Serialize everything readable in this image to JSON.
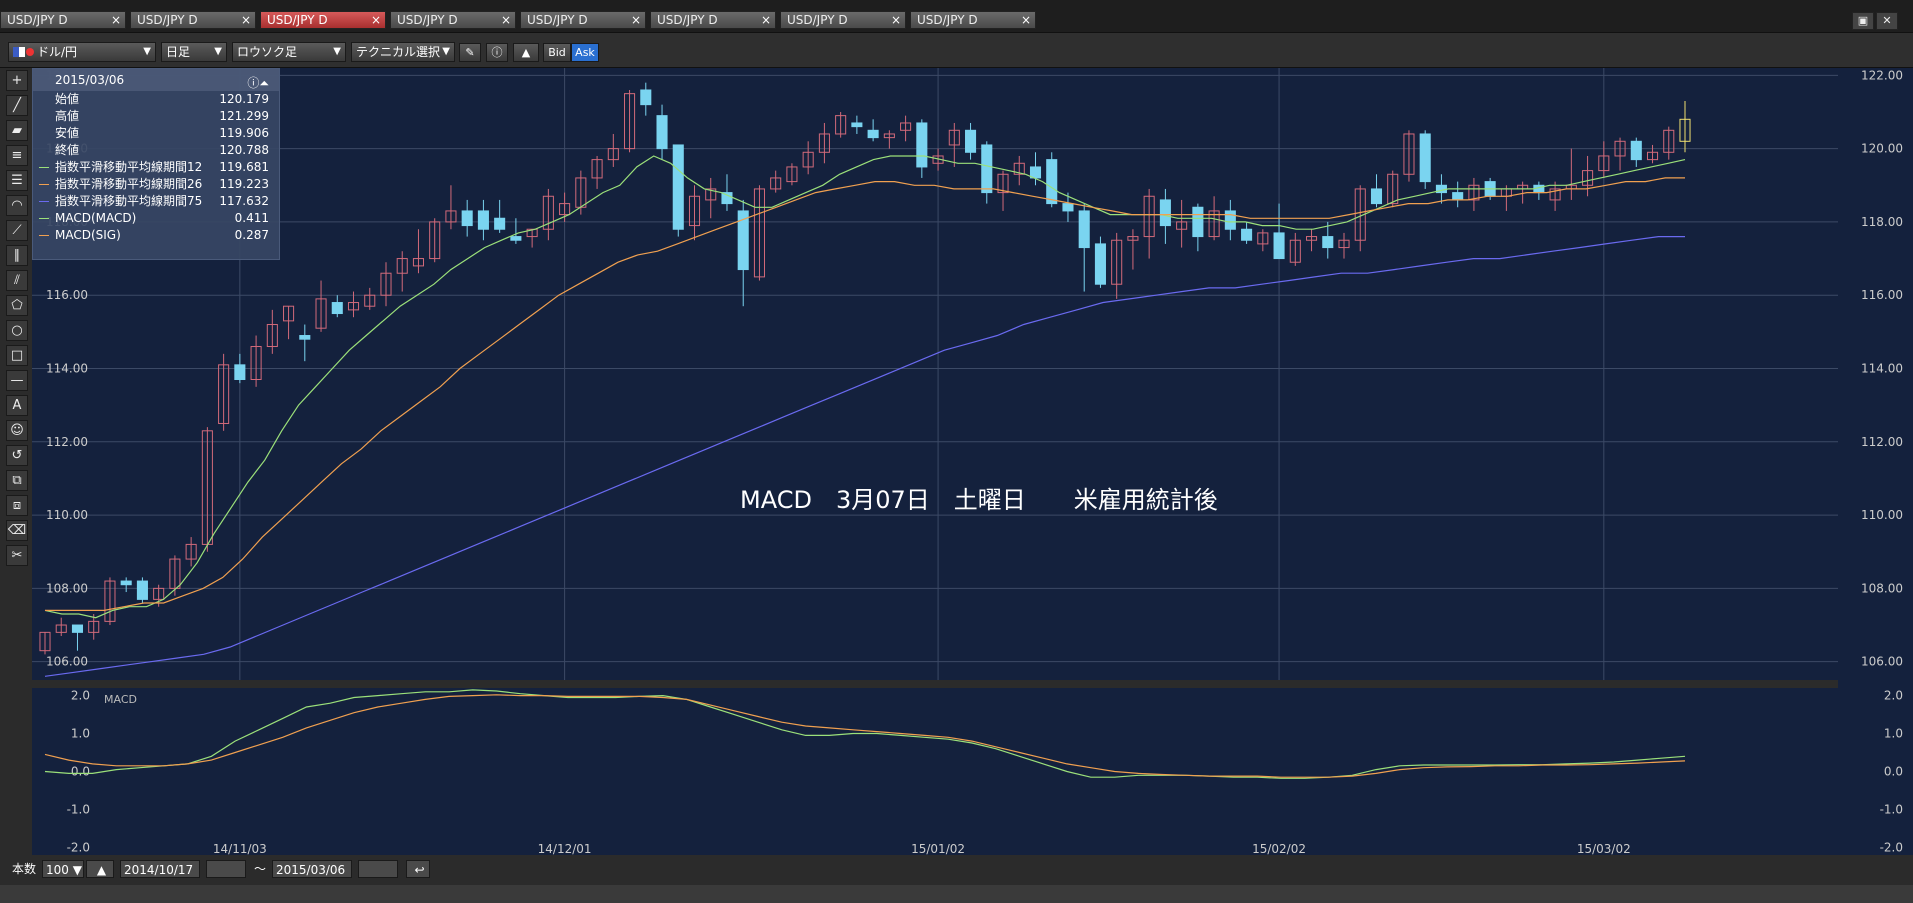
{
  "tabs": [
    {
      "label": "USD/JPY D",
      "active": false
    },
    {
      "label": "USD/JPY D",
      "active": false
    },
    {
      "label": "USD/JPY D",
      "active": true
    },
    {
      "label": "USD/JPY D",
      "active": false
    },
    {
      "label": "USD/JPY D",
      "active": false
    },
    {
      "label": "USD/JPY D",
      "active": false
    },
    {
      "label": "USD/JPY D",
      "active": false
    },
    {
      "label": "USD/JPY D",
      "active": false
    }
  ],
  "tab_close": "×",
  "toolbar": {
    "currency": "ドル/円",
    "period": "日足",
    "chart_type": "ロウソク足",
    "technical": "テクニカル選択",
    "bid": "Bid",
    "ask": "Ask"
  },
  "info": {
    "date": "2015/03/06",
    "rows": [
      {
        "label": "始値",
        "value": "120.179",
        "color": ""
      },
      {
        "label": "高値",
        "value": "121.299",
        "color": ""
      },
      {
        "label": "安値",
        "value": "119.906",
        "color": ""
      },
      {
        "label": "終値",
        "value": "120.788",
        "color": ""
      },
      {
        "label": "指数平滑移動平均線期間12",
        "value": "119.681",
        "color": "#9be07a"
      },
      {
        "label": "指数平滑移動平均線期間26",
        "value": "119.223",
        "color": "#f0a050"
      },
      {
        "label": "指数平滑移動平均線期間75",
        "value": "117.632",
        "color": "#6a6af0"
      },
      {
        "label": "MACD(MACD)",
        "value": "0.411",
        "color": "#9be07a"
      },
      {
        "label": "MACD(SIG)",
        "value": "0.287",
        "color": "#f0a050"
      }
    ]
  },
  "annotation": "MACD　3月07日　土曜日　　米雇用統計後",
  "bottom": {
    "count_label": "本数",
    "count_value": "100",
    "from_date": "2014/10/17",
    "tilde": "〜",
    "to_date": "2015/03/06"
  },
  "colors": {
    "bg": "#14213d",
    "up": "#7ad4f0",
    "down": "#d26a7a",
    "last": "#f0e070",
    "ema12": "#9be07a",
    "ema26": "#f0a050",
    "ema75": "#6a6af0",
    "grid": "#3c4a66"
  },
  "chart_data": {
    "type": "candlestick",
    "price_axis": {
      "ticks": [
        "122.00",
        "120.00",
        "118.00",
        "116.00",
        "114.00",
        "112.00",
        "110.00",
        "108.00",
        "106.00"
      ],
      "ylim": [
        105.5,
        122.2
      ]
    },
    "macd_axis": {
      "ticks": [
        "2.0",
        "1.0",
        "0.0",
        "-1.0",
        "-2.0"
      ],
      "ylim": [
        -2.2,
        2.2
      ],
      "label": "MACD"
    },
    "x_labels": [
      "14/11/03",
      "14/12/01",
      "15/01/02",
      "15/02/02",
      "15/03/02"
    ],
    "x_label_index": [
      12,
      32,
      55,
      76,
      96
    ],
    "candles": [
      [
        106.3,
        106.8,
        106.2,
        106.8
      ],
      [
        106.8,
        107.2,
        106.7,
        107.0
      ],
      [
        107.0,
        107.0,
        106.3,
        106.8
      ],
      [
        106.8,
        107.3,
        106.6,
        107.1
      ],
      [
        107.1,
        108.3,
        107.0,
        108.2
      ],
      [
        108.2,
        108.3,
        107.9,
        108.1
      ],
      [
        108.2,
        108.3,
        107.6,
        107.7
      ],
      [
        107.7,
        108.1,
        107.5,
        108.0
      ],
      [
        108.0,
        108.9,
        107.8,
        108.8
      ],
      [
        108.8,
        109.4,
        108.6,
        109.2
      ],
      [
        109.2,
        112.4,
        109.0,
        112.3
      ],
      [
        112.5,
        114.4,
        112.3,
        114.1
      ],
      [
        114.1,
        114.4,
        113.6,
        113.7
      ],
      [
        113.7,
        114.9,
        113.5,
        114.6
      ],
      [
        114.6,
        115.6,
        114.4,
        115.2
      ],
      [
        115.3,
        115.7,
        114.8,
        115.7
      ],
      [
        114.9,
        115.2,
        114.2,
        114.8
      ],
      [
        115.1,
        116.4,
        115.0,
        115.9
      ],
      [
        115.8,
        116.0,
        115.4,
        115.5
      ],
      [
        115.6,
        116.1,
        115.4,
        115.8
      ],
      [
        115.7,
        116.2,
        115.6,
        116.0
      ],
      [
        116.0,
        116.9,
        115.7,
        116.6
      ],
      [
        116.6,
        117.2,
        116.1,
        117.0
      ],
      [
        116.8,
        117.8,
        116.6,
        117.0
      ],
      [
        117.0,
        118.1,
        116.9,
        118.0
      ],
      [
        118.0,
        119.0,
        117.8,
        118.3
      ],
      [
        118.3,
        118.6,
        117.6,
        117.9
      ],
      [
        118.3,
        118.6,
        117.5,
        117.8
      ],
      [
        118.1,
        118.6,
        117.7,
        117.8
      ],
      [
        117.6,
        118.1,
        117.4,
        117.5
      ],
      [
        117.6,
        117.8,
        117.3,
        117.8
      ],
      [
        117.8,
        118.9,
        117.5,
        118.7
      ],
      [
        118.2,
        118.8,
        118.0,
        118.5
      ],
      [
        118.4,
        119.4,
        118.2,
        119.2
      ],
      [
        119.2,
        119.8,
        118.9,
        119.7
      ],
      [
        119.7,
        120.4,
        119.5,
        120.0
      ],
      [
        120.0,
        121.6,
        119.9,
        121.5
      ],
      [
        121.6,
        121.8,
        120.9,
        121.2
      ],
      [
        120.9,
        121.2,
        119.7,
        120.0
      ],
      [
        120.1,
        120.1,
        117.6,
        117.8
      ],
      [
        117.9,
        119.0,
        117.5,
        118.7
      ],
      [
        118.6,
        119.2,
        118.1,
        118.9
      ],
      [
        118.8,
        119.3,
        118.3,
        118.5
      ],
      [
        118.3,
        118.6,
        115.7,
        116.7
      ],
      [
        116.5,
        119.0,
        116.4,
        118.9
      ],
      [
        118.9,
        119.4,
        118.8,
        119.2
      ],
      [
        119.1,
        119.6,
        119.0,
        119.5
      ],
      [
        119.5,
        120.2,
        119.3,
        119.9
      ],
      [
        119.9,
        120.7,
        119.6,
        120.4
      ],
      [
        120.4,
        121.0,
        120.3,
        120.9
      ],
      [
        120.7,
        120.9,
        120.4,
        120.6
      ],
      [
        120.5,
        120.8,
        120.2,
        120.3
      ],
      [
        120.3,
        120.5,
        120.0,
        120.4
      ],
      [
        120.5,
        120.9,
        120.2,
        120.7
      ],
      [
        120.7,
        120.8,
        119.2,
        119.5
      ],
      [
        119.6,
        120.0,
        119.4,
        119.8
      ],
      [
        120.1,
        120.7,
        119.5,
        120.5
      ],
      [
        120.5,
        120.7,
        119.7,
        119.9
      ],
      [
        120.1,
        120.2,
        118.5,
        118.8
      ],
      [
        118.8,
        119.4,
        118.3,
        119.3
      ],
      [
        119.3,
        119.8,
        119.0,
        119.6
      ],
      [
        119.5,
        119.9,
        119.0,
        119.2
      ],
      [
        119.7,
        119.9,
        118.4,
        118.5
      ],
      [
        118.5,
        118.8,
        118.0,
        118.3
      ],
      [
        118.3,
        118.5,
        116.1,
        117.3
      ],
      [
        117.4,
        117.6,
        116.2,
        116.3
      ],
      [
        116.3,
        117.7,
        115.9,
        117.5
      ],
      [
        117.5,
        117.8,
        116.7,
        117.6
      ],
      [
        117.6,
        118.9,
        117.0,
        118.7
      ],
      [
        118.6,
        118.9,
        117.4,
        117.9
      ],
      [
        117.8,
        118.6,
        117.3,
        118.0
      ],
      [
        118.4,
        118.5,
        117.2,
        117.6
      ],
      [
        117.6,
        118.7,
        117.5,
        118.3
      ],
      [
        118.3,
        118.6,
        117.5,
        117.8
      ],
      [
        117.8,
        118.0,
        117.4,
        117.5
      ],
      [
        117.4,
        117.8,
        117.2,
        117.7
      ],
      [
        117.7,
        118.5,
        117.3,
        117.0
      ],
      [
        116.9,
        117.7,
        116.8,
        117.5
      ],
      [
        117.5,
        117.8,
        117.2,
        117.6
      ],
      [
        117.6,
        118.0,
        117.0,
        117.3
      ],
      [
        117.3,
        117.7,
        117.0,
        117.5
      ],
      [
        117.5,
        119.0,
        117.2,
        118.9
      ],
      [
        118.9,
        119.3,
        118.4,
        118.5
      ],
      [
        118.5,
        119.4,
        118.4,
        119.3
      ],
      [
        119.3,
        120.5,
        119.1,
        120.4
      ],
      [
        120.4,
        120.5,
        118.9,
        119.1
      ],
      [
        119.0,
        119.3,
        118.5,
        118.8
      ],
      [
        118.8,
        119.1,
        118.4,
        118.6
      ],
      [
        118.6,
        119.2,
        118.3,
        119.0
      ],
      [
        119.1,
        119.2,
        118.6,
        118.7
      ],
      [
        118.7,
        119.0,
        118.3,
        118.9
      ],
      [
        118.9,
        119.1,
        118.5,
        119.0
      ],
      [
        119.0,
        119.1,
        118.6,
        118.8
      ],
      [
        118.6,
        119.1,
        118.3,
        118.9
      ],
      [
        118.9,
        120.0,
        118.6,
        119.0
      ],
      [
        119.0,
        119.8,
        118.7,
        119.4
      ],
      [
        119.4,
        120.2,
        119.2,
        119.8
      ],
      [
        119.8,
        120.3,
        119.4,
        120.2
      ],
      [
        120.2,
        120.3,
        119.5,
        119.7
      ],
      [
        119.7,
        120.1,
        119.6,
        119.9
      ],
      [
        119.9,
        120.6,
        119.7,
        120.5
      ],
      [
        120.2,
        121.3,
        119.9,
        120.8
      ]
    ],
    "series": [
      {
        "name": "指数平滑移動平均線期間12",
        "color": "#9be07a",
        "values": [
          107.4,
          107.3,
          107.3,
          107.2,
          107.4,
          107.5,
          107.5,
          107.7,
          108.1,
          108.7,
          109.5,
          110.2,
          110.9,
          111.5,
          112.3,
          113.0,
          113.5,
          114.0,
          114.5,
          114.9,
          115.3,
          115.7,
          116.0,
          116.3,
          116.7,
          117.0,
          117.3,
          117.5,
          117.7,
          117.8,
          118.0,
          118.2,
          118.5,
          118.8,
          119.0,
          119.5,
          119.8,
          119.6,
          119.2,
          118.9,
          118.8,
          118.6,
          118.4,
          118.4,
          118.6,
          118.8,
          119.0,
          119.3,
          119.5,
          119.7,
          119.8,
          119.8,
          119.8,
          119.7,
          119.6,
          119.6,
          119.5,
          119.4,
          119.3,
          119.1,
          118.8,
          118.6,
          118.4,
          118.2,
          118.2,
          118.2,
          118.2,
          118.1,
          118.1,
          118.1,
          118.0,
          118.0,
          117.9,
          117.9,
          117.8,
          117.8,
          117.9,
          118.0,
          118.2,
          118.4,
          118.6,
          118.7,
          118.8,
          118.9,
          118.9,
          118.9,
          118.9,
          118.9,
          118.9,
          119.0,
          119.0,
          119.1,
          119.2,
          119.3,
          119.4,
          119.5,
          119.6,
          119.7
        ]
      },
      {
        "name": "指数平滑移動平均線期間26",
        "color": "#f0a050",
        "values": [
          107.4,
          107.4,
          107.4,
          107.4,
          107.5,
          107.6,
          107.6,
          107.8,
          108.0,
          108.3,
          108.8,
          109.4,
          109.9,
          110.4,
          110.9,
          111.4,
          111.8,
          112.3,
          112.7,
          113.1,
          113.5,
          114.0,
          114.4,
          114.8,
          115.2,
          115.6,
          116.0,
          116.3,
          116.6,
          116.9,
          117.1,
          117.2,
          117.4,
          117.6,
          117.8,
          118.0,
          118.2,
          118.4,
          118.6,
          118.8,
          118.9,
          119.0,
          119.1,
          119.1,
          119.0,
          119.0,
          118.9,
          118.9,
          118.9,
          118.8,
          118.7,
          118.6,
          118.5,
          118.4,
          118.3,
          118.2,
          118.2,
          118.2,
          118.2,
          118.2,
          118.2,
          118.1,
          118.1,
          118.1,
          118.1,
          118.1,
          118.2,
          118.3,
          118.4,
          118.5,
          118.5,
          118.6,
          118.6,
          118.7,
          118.7,
          118.8,
          118.8,
          118.9,
          118.9,
          119.0,
          119.1,
          119.1,
          119.2,
          119.2
        ]
      },
      {
        "name": "指数平滑移動平均線期間75",
        "color": "#6a6af0",
        "values": [
          105.6,
          105.7,
          105.8,
          105.9,
          106.0,
          106.1,
          106.2,
          106.4,
          106.7,
          107.0,
          107.3,
          107.6,
          107.9,
          108.2,
          108.5,
          108.8,
          109.1,
          109.4,
          109.7,
          110.0,
          110.3,
          110.6,
          110.9,
          111.2,
          111.5,
          111.8,
          112.1,
          112.4,
          112.7,
          113.0,
          113.3,
          113.6,
          113.9,
          114.2,
          114.5,
          114.7,
          114.9,
          115.2,
          115.4,
          115.6,
          115.8,
          115.9,
          116.0,
          116.1,
          116.2,
          116.2,
          116.3,
          116.4,
          116.5,
          116.6,
          116.6,
          116.7,
          116.8,
          116.9,
          117.0,
          117.0,
          117.1,
          117.2,
          117.3,
          117.4,
          117.5,
          117.6,
          117.6
        ]
      },
      {
        "name": "MACD(MACD)",
        "color": "#9be07a",
        "values": [
          0.0,
          -0.05,
          -0.05,
          0.05,
          0.1,
          0.15,
          0.2,
          0.4,
          0.8,
          1.1,
          1.4,
          1.7,
          1.8,
          1.95,
          2.0,
          2.05,
          2.1,
          2.1,
          2.15,
          2.12,
          2.05,
          2.0,
          1.95,
          1.95,
          1.95,
          1.98,
          2.0,
          1.9,
          1.7,
          1.5,
          1.3,
          1.1,
          0.95,
          0.95,
          1.0,
          1.0,
          0.95,
          0.9,
          0.85,
          0.75,
          0.6,
          0.4,
          0.2,
          0.0,
          -0.15,
          -0.15,
          -0.1,
          -0.1,
          -0.1,
          -0.12,
          -0.15,
          -0.15,
          -0.18,
          -0.18,
          -0.15,
          -0.1,
          0.05,
          0.15,
          0.17,
          0.17,
          0.17,
          0.17,
          0.18,
          0.18,
          0.2,
          0.22,
          0.25,
          0.3,
          0.35,
          0.4
        ]
      },
      {
        "name": "MACD(SIG)",
        "color": "#f0a050",
        "values": [
          0.45,
          0.3,
          0.2,
          0.15,
          0.15,
          0.15,
          0.2,
          0.3,
          0.5,
          0.7,
          0.9,
          1.15,
          1.35,
          1.55,
          1.7,
          1.8,
          1.9,
          1.98,
          2.0,
          2.02,
          2.0,
          2.0,
          1.98,
          1.98,
          1.98,
          1.98,
          1.95,
          1.9,
          1.75,
          1.6,
          1.45,
          1.3,
          1.2,
          1.15,
          1.1,
          1.05,
          1.0,
          0.95,
          0.9,
          0.8,
          0.65,
          0.5,
          0.35,
          0.2,
          0.1,
          0.0,
          -0.05,
          -0.08,
          -0.1,
          -0.12,
          -0.12,
          -0.12,
          -0.15,
          -0.15,
          -0.15,
          -0.12,
          -0.05,
          0.05,
          0.1,
          0.12,
          0.13,
          0.15,
          0.15,
          0.17,
          0.17,
          0.18,
          0.2,
          0.22,
          0.25,
          0.28
        ]
      }
    ]
  }
}
